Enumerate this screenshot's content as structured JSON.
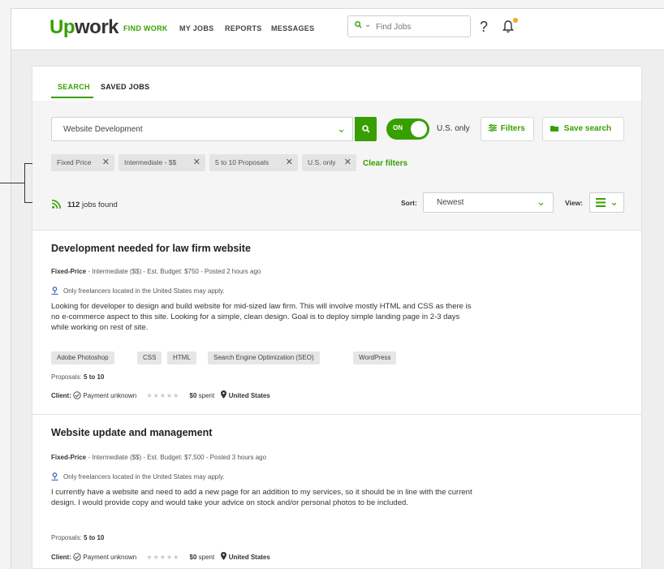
{
  "app": {
    "logo_up": "Up",
    "logo_rest": "work"
  },
  "nav": {
    "items": [
      "FIND WORK",
      "MY JOBS",
      "REPORTS",
      "MESSAGES"
    ],
    "search_placeholder": "Find Jobs",
    "help_label": "?"
  },
  "tabs": [
    "SEARCH",
    "SAVED JOBS"
  ],
  "search": {
    "keyword": "Website Development",
    "toggle_label": "ON",
    "us_only_label": "U.S. only",
    "filters_label": "Filters",
    "save_search_label": "Save search"
  },
  "filters": {
    "chips": [
      "Fixed Price",
      "Intermediate - $$",
      "5 to 10 Proposals",
      "U.S. only"
    ],
    "clear_label": "Clear filters"
  },
  "results": {
    "count": "112",
    "count_suffix": "jobs found",
    "sort_label": "Sort:",
    "sort_value": "Newest",
    "view_label": "View:"
  },
  "jobs": [
    {
      "title": "Development needed for law firm website",
      "type": "Fixed-Price",
      "meta": " - Intermediate ($$) - Est. Budget: $750 - Posted 2 hours ago",
      "location_note": "Only freelancers located in the United States may apply.",
      "description": "Looking for developer to design and build website for mid-sized law firm. This will involve mostly HTML and CSS as there is no e-commerce aspect to this site. Looking for a simple, clean design. Goal is to deploy simple landing page in 2-3 days while working on rest of site.",
      "skills": [
        "Adobe Photoshop",
        "CSS",
        "HTML",
        "Search Engine Optimization (SEO)",
        "WordPress"
      ],
      "proposals_label": "Proposals:",
      "proposals": "5 to 10",
      "client_label": "Client:",
      "payment": "Payment unknown",
      "stars": "★★★★★",
      "spent_amount": "$0",
      "spent_label": "spent",
      "country": "United States"
    },
    {
      "title": "Website update and management",
      "type": "Fixed-Price",
      "meta": " - Intermediate ($$) - Est. Budget: $7,500 - Posted 3 hours ago",
      "location_note": "Only freelancers located in the United States may apply.",
      "description": "I currently have a website and need to add a new page for an addition to my services, so it should be in line with the current design. I would provide copy and would take your advice on stock and/or personal photos to be included.",
      "proposals_label": "Proposals:",
      "proposals": "5 to 10",
      "client_label": "Client:",
      "payment": "Payment unknown",
      "stars": "★★★★★",
      "spent_amount": "$0",
      "spent_label": "spent",
      "country": "United States"
    }
  ],
  "colors": {
    "brand_green": "#37a000",
    "notification_dot": "#f5a623"
  },
  "icons": [
    "search-icon",
    "chevron-down-icon",
    "help-icon",
    "bell-icon",
    "filter-icon",
    "folder-icon",
    "close-icon",
    "rss-icon",
    "list-view-icon",
    "location-pin-icon",
    "verified-check-icon",
    "map-marker-icon"
  ]
}
